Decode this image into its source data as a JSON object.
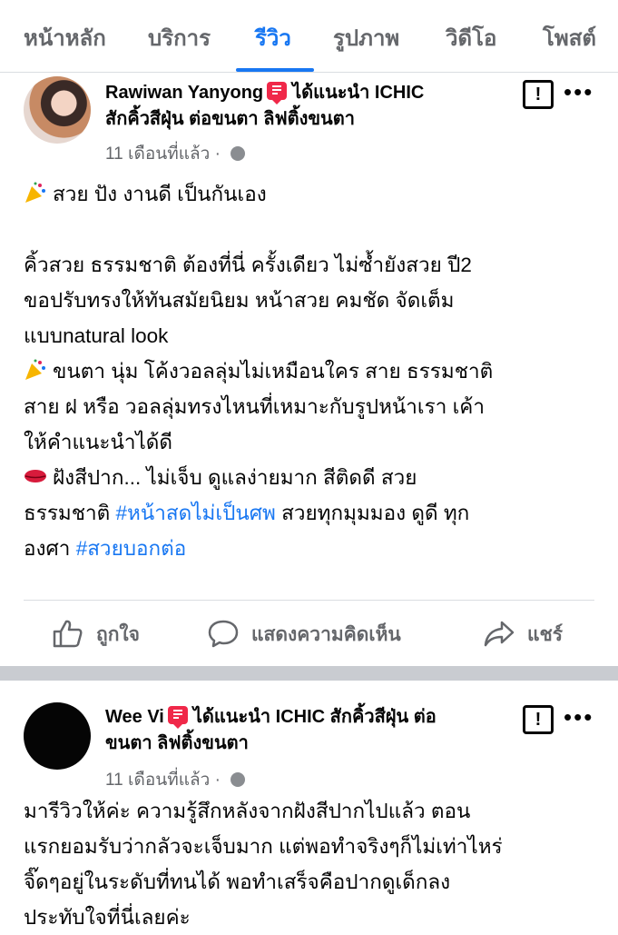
{
  "tabs": [
    {
      "label": "หน้าหลัก",
      "active": false
    },
    {
      "label": "บริการ",
      "active": false
    },
    {
      "label": "รีวิว",
      "active": true
    },
    {
      "label": "รูปภาพ",
      "active": false
    },
    {
      "label": "วิดีโอ",
      "active": false
    },
    {
      "label": "โพสต์",
      "active": false
    }
  ],
  "accent_color": "#1877f2",
  "recommend_icon_color": "#f02849",
  "posts": [
    {
      "author": "Rawiwan Yanyong",
      "recommend_text": "ได้แนะนำ ICHIC",
      "page_name": "สักคิ้วสีฝุ่น ต่อขนตา ลิฟติ้งขนตา",
      "time": "11 เดือนที่แล้ว",
      "privacy_icon": "globe-icon",
      "lines": [
        "สวย ปัง งานดี เป็นกันเอง",
        "",
        "คิ้วสวย ธรรมชาติ ต้องที่นี่ ครั้งเดียว ไม่ซ้ำยังสวย ปี2",
        "ขอปรับทรงให้ทันสมัยนิยม หน้าสวย คมชัด จัดเต็ม",
        "แบบnatural look",
        "ขนตา นุ่ม โค้งวอลลุ่มไม่เหมือนใคร สาย ธรรมชาติ",
        "สาย ฝ หรือ วอลลุ่มทรงไหนที่เหมาะกับรูปหน้าเรา เค้า",
        "ให้คำแนะนำได้ดี",
        "ฝังสีปาก... ไม่เจ็บ ดูแลง่ายมาก สีติดดี สวย",
        "ธรรมชาติ",
        "#หน้าสดไม่เป็นศพ",
        "สวยทุกมุมมอง ดูดี ทุก",
        "องศา",
        "#สวยบอกต่อ"
      ]
    },
    {
      "author": "Wee Vi",
      "recommend_text": "ได้แนะนำ ICHIC สักคิ้วสีฝุ่น ต่อ",
      "page_name": "ขนตา ลิฟติ้งขนตา",
      "time": "11 เดือนที่แล้ว",
      "privacy_icon": "globe-icon",
      "lines": [
        "มารีวิวให้ค่ะ ความรู้สึกหลังจากฝังสีปากไปแล้ว ตอน",
        "แรกยอมรับว่ากลัวจะเจ็บมาก แต่พอทำจริงๆก็ไม่เท่าไหร่",
        "จิ๊ดๆอยู่ในระดับที่ทนได้ พอทำเสร็จคือปากดูเด็กลง",
        "ประทับใจที่นี่เลยค่ะ"
      ]
    }
  ],
  "actions": {
    "like": "ถูกใจ",
    "comment": "แสดงความคิดเห็น",
    "share": "แชร์"
  }
}
